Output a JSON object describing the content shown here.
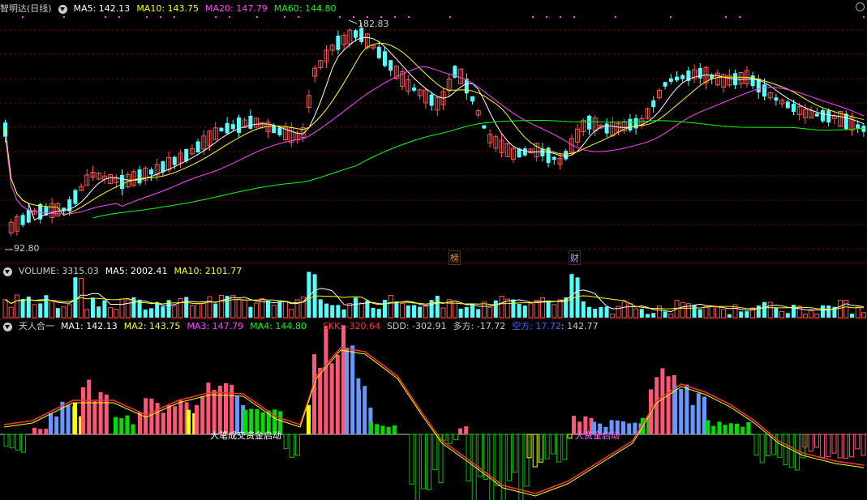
{
  "main": {
    "title": "智明达(日线)",
    "ma5": "MA5: 142.13",
    "ma10": "MA10: 143.75",
    "ma20": "MA20: 147.79",
    "ma60": "MA60: 144.80",
    "high_label": "182.83",
    "low_label": "92.80",
    "marker_bang": "榜",
    "marker_cai": "财"
  },
  "volume": {
    "label": "VOLUME: 3315.03",
    "ma5": "MA5: 2002.41",
    "ma10": "MA10: 2101.77"
  },
  "indicator": {
    "title": "天人合一",
    "ma1": "MA1: 142.13",
    "ma2": "MA2: 143.75",
    "ma3": "MA3: 147.79",
    "ma4": "MA4: 144.80",
    "skk": "SKK: -320.64",
    "sdd": "SDD: -302.91",
    "duofang": "多方: -17.72",
    "kongfang": "空方: 17.72",
    "last": ": 142.77",
    "note_a": "大笔成交资金启动",
    "note_b": "大资金启动"
  },
  "colors": {
    "up": "#ff5555",
    "down": "#54ffff",
    "ma5": "#ffffff",
    "ma10": "#ffff00",
    "ma20": "#ff44ff",
    "ma60": "#00ff00",
    "grid": "#8b0000"
  }
}
